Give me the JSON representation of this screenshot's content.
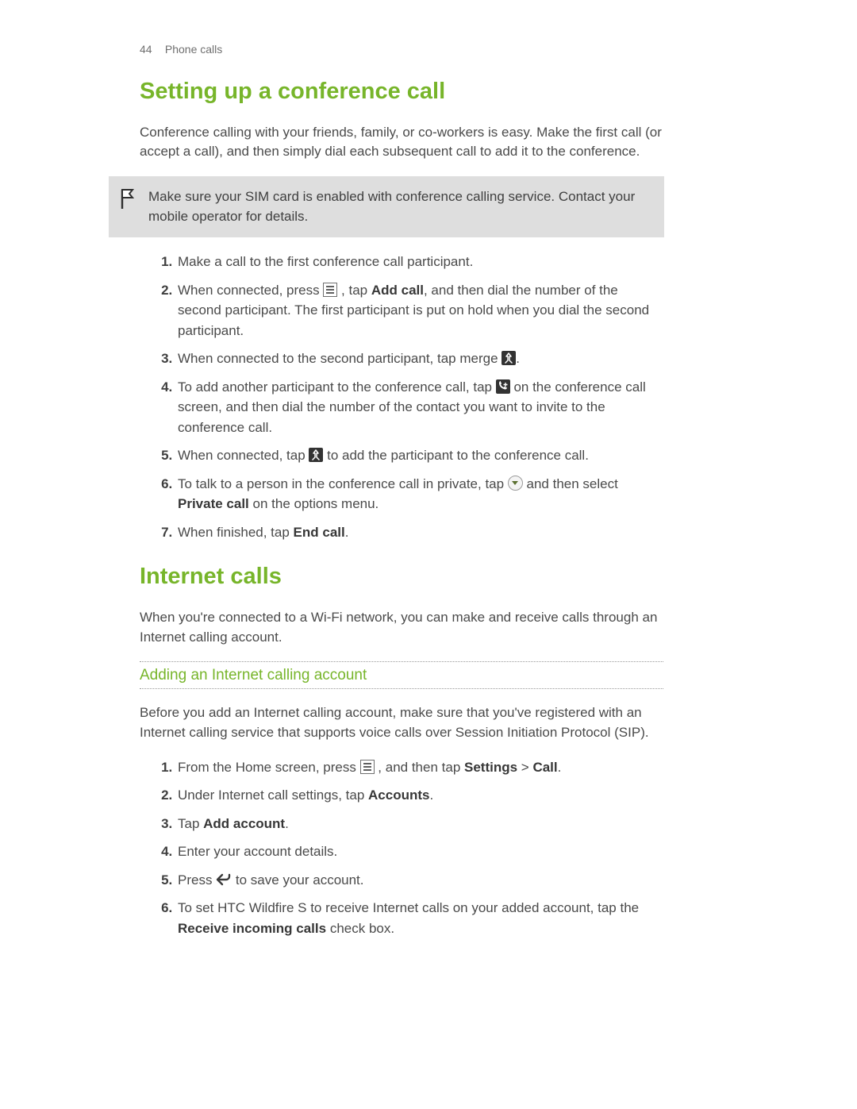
{
  "header": {
    "page_number": "44",
    "chapter": "Phone calls"
  },
  "section1": {
    "title": "Setting up a conference call",
    "intro": "Conference calling with your friends, family, or co-workers is easy. Make the first call (or accept a call), and then simply dial each subsequent call to add it to the conference.",
    "note": "Make sure your SIM card is enabled with conference calling service. Contact your mobile operator for details.",
    "steps": {
      "s1": "Make a call to the first conference call participant.",
      "s2_a": "When connected, press ",
      "s2_b": " , tap ",
      "s2_bold1": "Add call",
      "s2_c": ", and then dial the number of the second participant. The first participant is put on hold when you dial the second participant.",
      "s3_a": "When connected to the second participant, tap merge ",
      "s3_b": ".",
      "s4_a": "To add another participant to the conference call, tap ",
      "s4_b": " on the conference call screen, and then dial the number of the contact you want to invite to the conference call.",
      "s5_a": "When connected, tap ",
      "s5_b": " to add the participant to the conference call.",
      "s6_a": "To talk to a person in the conference call in private, tap ",
      "s6_b": " and then select ",
      "s6_bold": "Private call",
      "s6_c": " on the options menu.",
      "s7_a": "When finished, tap ",
      "s7_bold": "End call",
      "s7_b": "."
    }
  },
  "section2": {
    "title": "Internet calls",
    "intro": "When you're connected to a Wi-Fi network, you can make and receive calls through an Internet calling account.",
    "sub_title": "Adding an Internet calling account",
    "sub_intro": "Before you add an Internet calling account, make sure that you've registered with an Internet calling service that supports voice calls over Session Initiation Protocol (SIP).",
    "steps": {
      "s1_a": "From the Home screen, press ",
      "s1_b": " , and then tap ",
      "s1_bold1": "Settings",
      "s1_gt": " > ",
      "s1_bold2": "Call",
      "s1_c": ".",
      "s2_a": "Under Internet call settings, tap ",
      "s2_bold": "Accounts",
      "s2_b": ".",
      "s3_a": "Tap ",
      "s3_bold": "Add account",
      "s3_b": ".",
      "s4": "Enter your account details.",
      "s5_a": "Press ",
      "s5_b": " to save your account.",
      "s6_a": "To set HTC Wildfire S to receive Internet calls on your added account, tap the ",
      "s6_bold": "Receive incoming calls",
      "s6_b": " check box."
    }
  }
}
